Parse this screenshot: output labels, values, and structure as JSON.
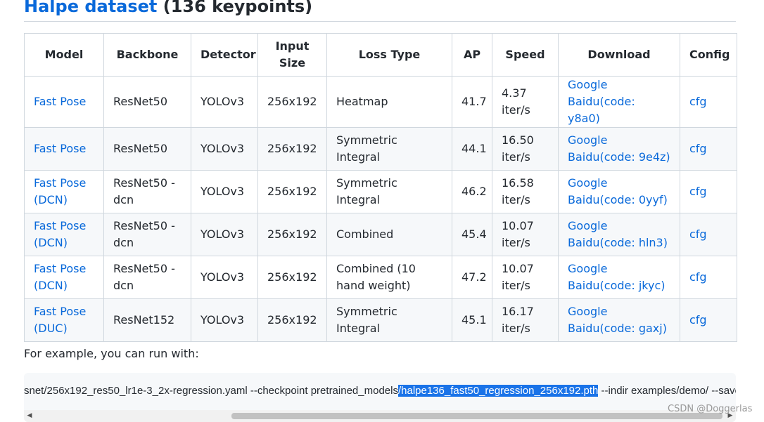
{
  "heading": {
    "link_text": "Halpe dataset",
    "suffix": " (136 keypoints)"
  },
  "table": {
    "headers": {
      "model": "Model",
      "backbone": "Backbone",
      "detector": "Detector",
      "input_size": "Input Size",
      "loss_type": "Loss Type",
      "ap": "AP",
      "speed": "Speed",
      "download": "Download",
      "config": "Config"
    },
    "rows": [
      {
        "model": "Fast Pose",
        "backbone": "ResNet50",
        "detector": "YOLOv3",
        "input_size": "256x192",
        "loss_type": "Heatmap",
        "ap": "41.7",
        "speed": "4.37 iter/s",
        "google": "Google",
        "baidu": "Baidu(code: y8a0)",
        "config": "cfg"
      },
      {
        "model": "Fast Pose",
        "backbone": "ResNet50",
        "detector": "YOLOv3",
        "input_size": "256x192",
        "loss_type": "Symmetric Integral",
        "ap": "44.1",
        "speed": "16.50 iter/s",
        "google": "Google",
        "baidu": "Baidu(code: 9e4z)",
        "config": "cfg"
      },
      {
        "model": "Fast Pose (DCN)",
        "backbone": "ResNet50 - dcn",
        "detector": "YOLOv3",
        "input_size": "256x192",
        "loss_type": "Symmetric Integral",
        "ap": "46.2",
        "speed": "16.58 iter/s",
        "google": "Google",
        "baidu": "Baidu(code: 0yyf)",
        "config": "cfg"
      },
      {
        "model": "Fast Pose (DCN)",
        "backbone": "ResNet50 - dcn",
        "detector": "YOLOv3",
        "input_size": "256x192",
        "loss_type": "Combined",
        "ap": "45.4",
        "speed": "10.07 iter/s",
        "google": "Google",
        "baidu": "Baidu(code: hln3)",
        "config": "cfg"
      },
      {
        "model": "Fast Pose (DCN)",
        "backbone": "ResNet50 - dcn",
        "detector": "YOLOv3",
        "input_size": "256x192",
        "loss_type": "Combined (10 hand weight)",
        "ap": "47.2",
        "speed": "10.07 iter/s",
        "google": "Google",
        "baidu": "Baidu(code: jkyc)",
        "config": "cfg"
      },
      {
        "model": "Fast Pose (DUC)",
        "backbone": "ResNet152",
        "detector": "YOLOv3",
        "input_size": "256x192",
        "loss_type": "Symmetric Integral",
        "ap": "45.1",
        "speed": "16.17 iter/s",
        "google": "Google",
        "baidu": "Baidu(code: gaxj)",
        "config": "cfg"
      }
    ]
  },
  "paragraph": "For example, you can run with:",
  "code": {
    "before_selection": "snet/256x192_res50_lr1e-3_2x-regression.yaml --checkpoint pretrained_models",
    "selected": "/halpe136_fast50_regression_256x192.pth",
    "after_selection": " --indir examples/demo/ --save_img",
    "selection_color": "#1a73e8"
  },
  "scrollbar": {
    "left_arrow_icon": "triangle-left-icon",
    "right_arrow_icon": "triangle-right-icon",
    "left_arrow": "◀",
    "right_arrow": "▶"
  },
  "watermark": "CSDN @Doggerlas",
  "colors": {
    "link": "#0969da",
    "border": "#d0d7de",
    "stripe": "#f6f8fa",
    "text": "#24292f"
  }
}
